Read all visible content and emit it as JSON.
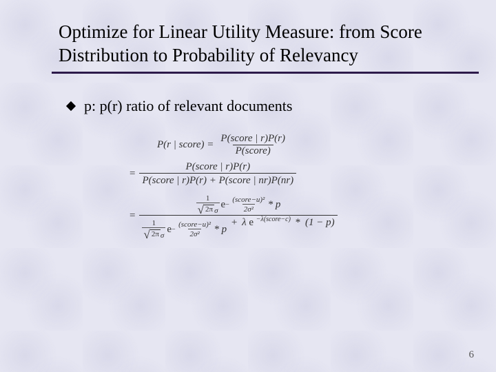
{
  "title": "Optimize for Linear Utility Measure: from Score Distribution to Probability of Relevancy",
  "bullet": "p: p(r)  ratio of relevant documents",
  "eq": {
    "line1_lhs": "P(r | score) =",
    "line1_num": "P(score | r)P(r)",
    "line1_den": "P(score)",
    "line2_eq": "=",
    "line2_num": "P(score | r)P(r)",
    "line2_den": "P(score | r)P(r) + P(score | nr)P(nr)",
    "line3_eq": "=",
    "gauss_coeff_num": "1",
    "sqrt2pi": "2π",
    "sigma": "σ",
    "e": "e",
    "gexp_num": "(score−u)²",
    "gexp_den": "2σ²",
    "negsign_exp": "−",
    "star": "*",
    "p": "p",
    "plus": "+",
    "lambda": "λ",
    "lamexp": "−λ(score−c)",
    "one_minus_p": "(1 − p)"
  },
  "page": "6"
}
